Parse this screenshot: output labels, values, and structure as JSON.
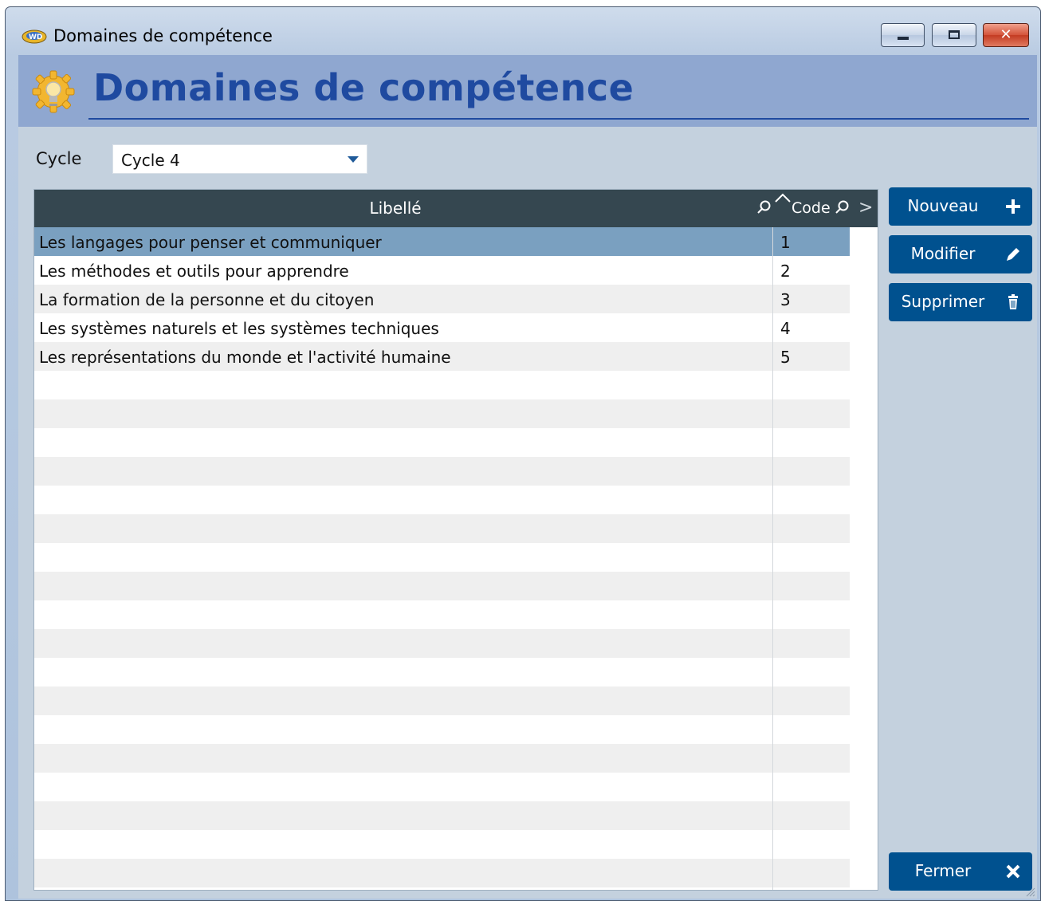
{
  "window": {
    "title": "Domaines de compétence",
    "controls": [
      "minimize-icon",
      "maximize-icon",
      "close-icon"
    ],
    "close_glyph": "✕"
  },
  "header": {
    "title": "Domaines de compétence",
    "icon": "gear-bulb-icon"
  },
  "filter": {
    "label": "Cycle",
    "value": "Cycle 4"
  },
  "table": {
    "columns": [
      "Libellé",
      "Code"
    ],
    "rows": [
      {
        "libelle": "Les langages pour penser et communiquer",
        "code": "1"
      },
      {
        "libelle": "Les méthodes et outils pour apprendre",
        "code": "2"
      },
      {
        "libelle": "La formation de la personne et du citoyen",
        "code": "3"
      },
      {
        "libelle": "Les systèmes naturels et les systèmes techniques",
        "code": "4"
      },
      {
        "libelle": "Les représentations du monde et l'activité humaine",
        "code": "5"
      }
    ],
    "selected_row": 0,
    "empty_rows": 18,
    "scroll_glyph": ">"
  },
  "actions": {
    "new_label": "Nouveau",
    "edit_label": "Modifier",
    "delete_label": "Supprimer",
    "close_label": "Fermer"
  },
  "colors": {
    "header_band": "#8fa7d0",
    "title_blue": "#1f4aa0",
    "button_blue": "#00518f",
    "table_header": "#354750",
    "selected_row": "#7aa0c0"
  }
}
